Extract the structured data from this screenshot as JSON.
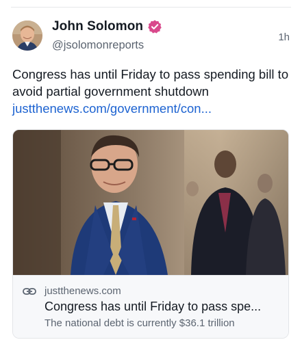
{
  "author": {
    "display_name": "John Solomon",
    "handle": "@jsolomonreports",
    "verified": true,
    "verified_badge_color": "#d9498c"
  },
  "post": {
    "time_ago": "1h",
    "text": "Congress has until Friday to pass spending bill to avoid partial government shutdown",
    "link_display": "justthenews.com/government/con...",
    "link_color": "#1d63d1"
  },
  "link_card": {
    "domain": "justthenews.com",
    "title": "Congress has until Friday to pass spe...",
    "description": "The national debt is currently $36.1 trillion"
  },
  "icons": {
    "verified": "verified-badge-icon",
    "link": "link-chain-icon"
  }
}
